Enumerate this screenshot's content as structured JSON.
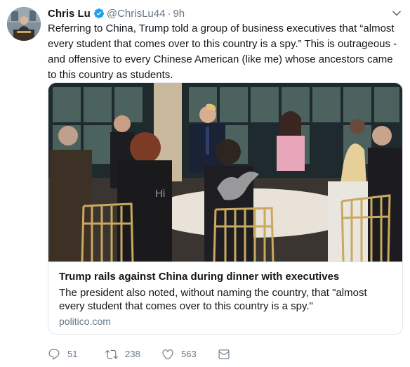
{
  "tweet": {
    "author_name": "Chris Lu",
    "handle": "@ChrisLu44",
    "separator": "·",
    "time": "9h",
    "text": "Referring to China, Trump told a group of business executives that “almost every student that comes over to this country is a spy.” This is outrageous - and offensive to every Chinese American (like me) whose ancestors came to this country as students."
  },
  "card": {
    "title": "Trump rails against China during dinner with executives",
    "description": "The president also noted, without naming the country, that \"almost every student that comes over to this country is a spy.\"",
    "domain": "politico.com",
    "watermark_text": "Hi"
  },
  "actions": {
    "reply_count": "51",
    "retweet_count": "238",
    "like_count": "563"
  },
  "icons": {
    "verified": "verified-badge-icon",
    "caret": "chevron-down-icon",
    "reply": "reply-icon",
    "retweet": "retweet-icon",
    "like": "heart-icon",
    "message": "mail-icon"
  },
  "colors": {
    "verified_blue": "#1da1f2",
    "secondary_text": "#657786",
    "border": "#e1e8ed"
  }
}
